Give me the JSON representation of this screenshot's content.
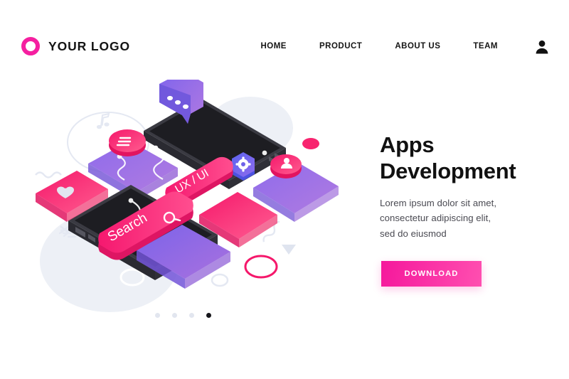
{
  "header": {
    "brand": {
      "name": "YOUR LOGO",
      "logo_icon": "ring-logo-icon",
      "logo_color": "#F51FA0"
    },
    "nav": [
      {
        "label": "HOME"
      },
      {
        "label": "PRODUCT"
      },
      {
        "label": "ABOUT US"
      },
      {
        "label": "TEAM"
      }
    ],
    "account_icon": "user-avatar-icon"
  },
  "hero": {
    "title_line1": "Apps",
    "title_line2": "Development",
    "paragraph_line1": "Lorem ipsum dolor sit amet,",
    "paragraph_line2": "consectetur adipiscing elit,",
    "paragraph_line3": "sed do eiusmod",
    "cta_label": "DOWNLOAD",
    "cta_color": "#F5189C"
  },
  "carousel": {
    "dots": [
      {
        "active": false
      },
      {
        "active": false
      },
      {
        "active": false
      },
      {
        "active": true
      }
    ],
    "active_index": 4,
    "total": 4
  },
  "illustration": {
    "name": "isometric-apps-development-illustration",
    "labels": {
      "search": "Search",
      "uxui": "UX / UI"
    },
    "icons": [
      "chat-bubble-icon",
      "menu-lines-icon",
      "heart-icon",
      "search-magnifier-icon",
      "gear-settings-icon",
      "user-profile-icon",
      "music-note-icon"
    ],
    "palette": {
      "pink": "#F5196B",
      "magenta": "#F5189C",
      "purple": "#7B5CE0",
      "violet": "#9B6BE8",
      "dark": "#26262B",
      "light_gray": "#E8EBF2"
    }
  }
}
